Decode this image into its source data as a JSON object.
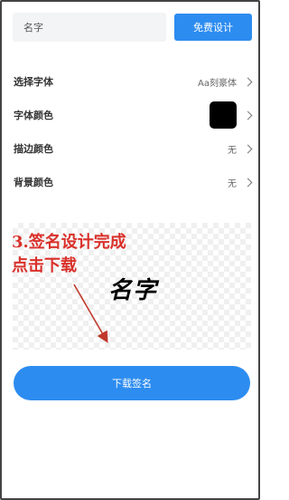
{
  "top_bar": {
    "name_placeholder": "名字",
    "design_button": "免费设计"
  },
  "settings": [
    {
      "label": "选择字体",
      "value": "Aa刻豪体",
      "kind": "text"
    },
    {
      "label": "字体颜色",
      "value": "",
      "kind": "color",
      "color": "#000000"
    },
    {
      "label": "描边颜色",
      "value": "无",
      "kind": "text"
    },
    {
      "label": "背景颜色",
      "value": "无",
      "kind": "text"
    }
  ],
  "preview": {
    "signature_text": "名字"
  },
  "annotation": {
    "line1": "3.签名设计完成",
    "line2": "点击下载",
    "color": "#d9302a"
  },
  "download_button": "下载签名",
  "colors": {
    "accent": "#2d8cf0"
  }
}
